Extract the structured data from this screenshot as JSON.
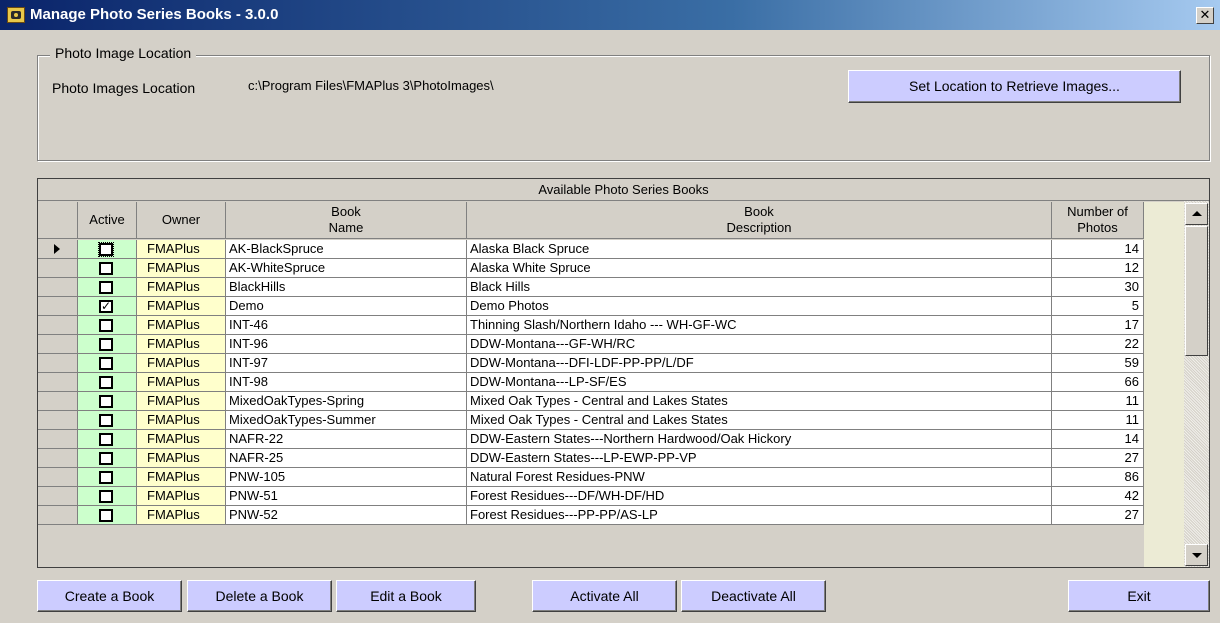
{
  "window": {
    "title": "Manage Photo Series Books - 3.0.0",
    "close_glyph": "✕"
  },
  "location_group": {
    "legend": "Photo Image Location",
    "label": "Photo Images Location",
    "path": "c:\\Program Files\\FMAPlus 3\\PhotoImages\\",
    "set_button": "Set Location to Retrieve Images..."
  },
  "grid": {
    "caption": "Available Photo Series Books",
    "headers": {
      "active": "Active",
      "owner": "Owner",
      "name": "Book\nName",
      "description": "Book\nDescription",
      "photos": "Number of\nPhotos"
    },
    "rows": [
      {
        "active": false,
        "owner": "FMAPlus",
        "name": "AK-BlackSpruce",
        "description": "Alaska Black Spruce",
        "photos": "14"
      },
      {
        "active": false,
        "owner": "FMAPlus",
        "name": "AK-WhiteSpruce",
        "description": "Alaska White Spruce",
        "photos": "12"
      },
      {
        "active": false,
        "owner": "FMAPlus",
        "name": "BlackHills",
        "description": "Black Hills",
        "photos": "30"
      },
      {
        "active": true,
        "owner": "FMAPlus",
        "name": "Demo",
        "description": "Demo Photos",
        "photos": "5"
      },
      {
        "active": false,
        "owner": "FMAPlus",
        "name": "INT-46",
        "description": "Thinning Slash/Northern Idaho --- WH-GF-WC",
        "photos": "17"
      },
      {
        "active": false,
        "owner": "FMAPlus",
        "name": "INT-96",
        "description": "DDW-Montana---GF-WH/RC",
        "photos": "22"
      },
      {
        "active": false,
        "owner": "FMAPlus",
        "name": "INT-97",
        "description": "DDW-Montana---DFI-LDF-PP-PP/L/DF",
        "photos": "59"
      },
      {
        "active": false,
        "owner": "FMAPlus",
        "name": "INT-98",
        "description": "DDW-Montana---LP-SF/ES",
        "photos": "66"
      },
      {
        "active": false,
        "owner": "FMAPlus",
        "name": "MixedOakTypes-Spring",
        "description": "Mixed Oak Types - Central and Lakes States",
        "photos": "11"
      },
      {
        "active": false,
        "owner": "FMAPlus",
        "name": "MixedOakTypes-Summer",
        "description": "Mixed Oak Types - Central and Lakes States",
        "photos": "11"
      },
      {
        "active": false,
        "owner": "FMAPlus",
        "name": "NAFR-22",
        "description": "DDW-Eastern States---Northern Hardwood/Oak Hickory",
        "photos": "14"
      },
      {
        "active": false,
        "owner": "FMAPlus",
        "name": "NAFR-25",
        "description": "DDW-Eastern States---LP-EWP-PP-VP",
        "photos": "27"
      },
      {
        "active": false,
        "owner": "FMAPlus",
        "name": "PNW-105",
        "description": "Natural Forest Residues-PNW",
        "photos": "86"
      },
      {
        "active": false,
        "owner": "FMAPlus",
        "name": "PNW-51",
        "description": "Forest Residues---DF/WH-DF/HD",
        "photos": "42"
      },
      {
        "active": false,
        "owner": "FMAPlus",
        "name": "PNW-52",
        "description": "Forest Residues---PP-PP/AS-LP",
        "photos": "27"
      }
    ]
  },
  "buttons": {
    "create": "Create a Book",
    "delete": "Delete a Book",
    "edit": "Edit a Book",
    "activate_all": "Activate All",
    "deactivate_all": "Deactivate All",
    "exit": "Exit"
  },
  "colors": {
    "button_face": "#ccccff",
    "active_column": "#ccffcc",
    "owner_column": "#ffffcc"
  }
}
